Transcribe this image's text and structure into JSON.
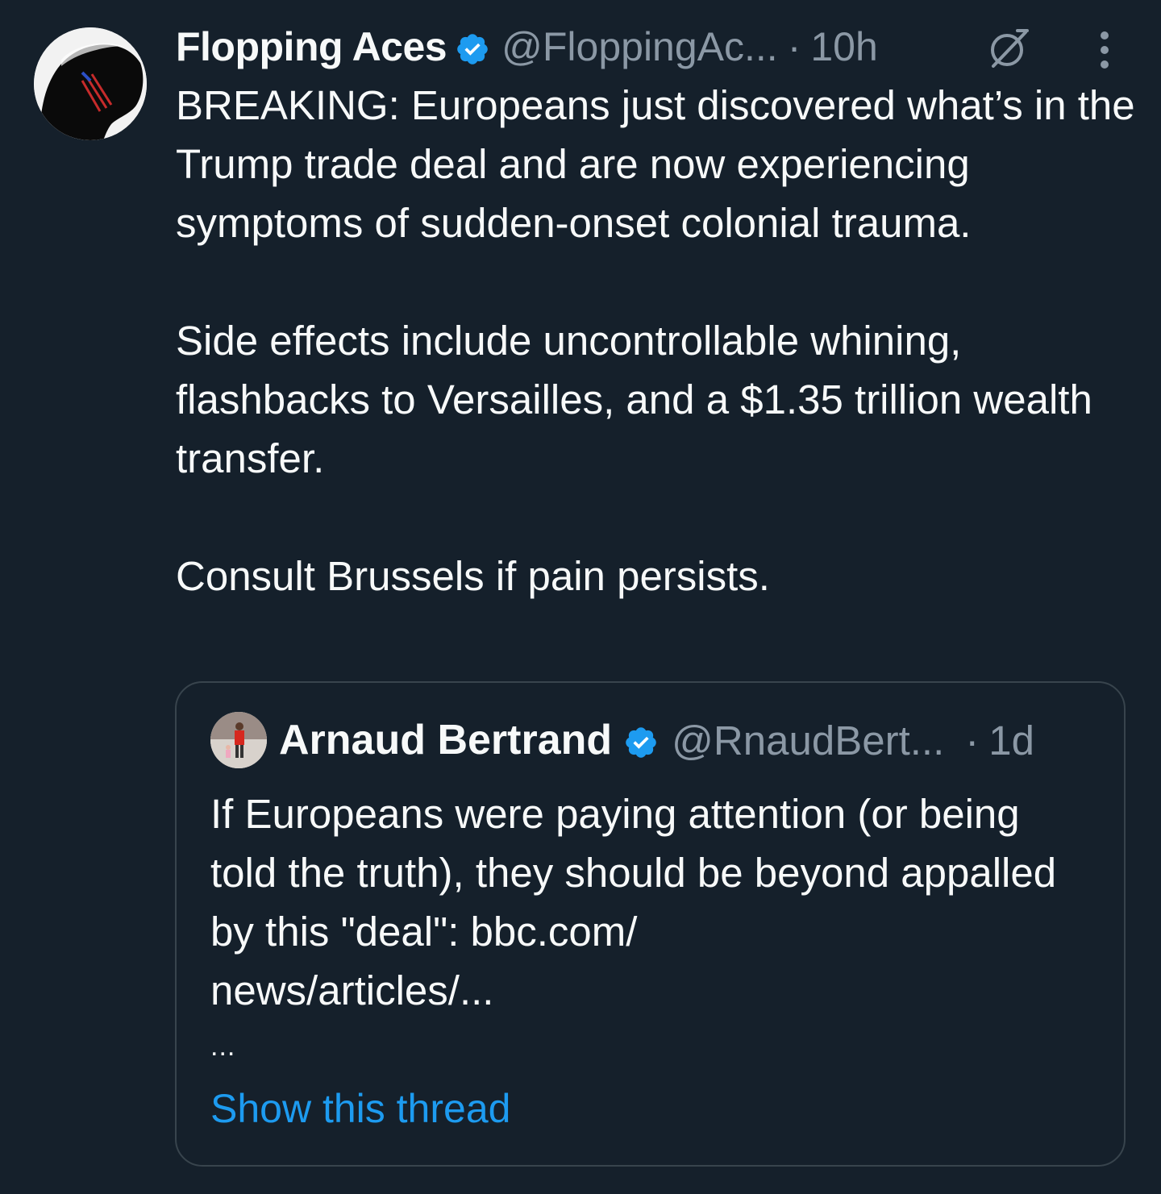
{
  "tweet": {
    "author": {
      "display_name": "Flopping Aces",
      "handle": "@FloppingAc...",
      "verified": true
    },
    "separator": "·",
    "timestamp": "10h",
    "text": {
      "paragraph_1": "BREAKING: Europeans just discovered what’s in the Trump trade deal and are now experiencing symptoms of sudden-onset colonial trauma.",
      "paragraph_2": "Side effects include uncontrollable whining, flashbacks to Versailles, and a $1.35 trillion wealth transfer.",
      "paragraph_3": "Consult Brussels if pain persists."
    },
    "icons": {
      "grok": "grok-icon",
      "more": "more-options-icon",
      "verified": "verified-badge-icon"
    }
  },
  "quoted_tweet": {
    "author": {
      "display_name": "Arnaud Bertrand",
      "handle": "@RnaudBert...",
      "verified": true
    },
    "separator": "·",
    "timestamp": "1d",
    "text": "If Europeans were paying attention (or being told the truth), they should be beyond appalled by this \"deal\": bbc.com/\nnews/articles/...",
    "truncation": "...",
    "show_thread_label": "Show this thread"
  },
  "colors": {
    "background": "#15202b",
    "text_primary": "#f7f9f9",
    "text_secondary": "#8b98a5",
    "accent": "#1d9bf0",
    "border": "#38444d"
  }
}
